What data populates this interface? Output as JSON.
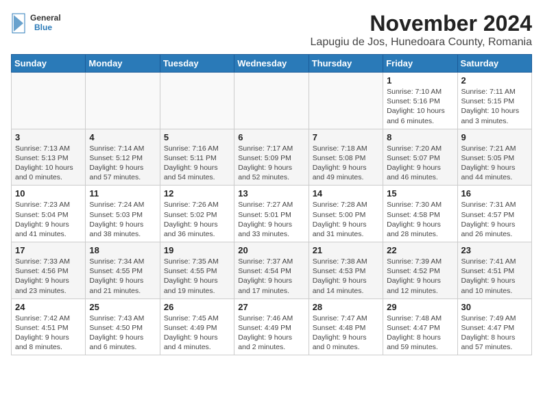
{
  "header": {
    "logo_general": "General",
    "logo_blue": "Blue",
    "month_title": "November 2024",
    "location": "Lapugiu de Jos, Hunedoara County, Romania"
  },
  "weekdays": [
    "Sunday",
    "Monday",
    "Tuesday",
    "Wednesday",
    "Thursday",
    "Friday",
    "Saturday"
  ],
  "weeks": [
    [
      {
        "day": "",
        "info": ""
      },
      {
        "day": "",
        "info": ""
      },
      {
        "day": "",
        "info": ""
      },
      {
        "day": "",
        "info": ""
      },
      {
        "day": "",
        "info": ""
      },
      {
        "day": "1",
        "info": "Sunrise: 7:10 AM\nSunset: 5:16 PM\nDaylight: 10 hours\nand 6 minutes."
      },
      {
        "day": "2",
        "info": "Sunrise: 7:11 AM\nSunset: 5:15 PM\nDaylight: 10 hours\nand 3 minutes."
      }
    ],
    [
      {
        "day": "3",
        "info": "Sunrise: 7:13 AM\nSunset: 5:13 PM\nDaylight: 10 hours\nand 0 minutes."
      },
      {
        "day": "4",
        "info": "Sunrise: 7:14 AM\nSunset: 5:12 PM\nDaylight: 9 hours\nand 57 minutes."
      },
      {
        "day": "5",
        "info": "Sunrise: 7:16 AM\nSunset: 5:11 PM\nDaylight: 9 hours\nand 54 minutes."
      },
      {
        "day": "6",
        "info": "Sunrise: 7:17 AM\nSunset: 5:09 PM\nDaylight: 9 hours\nand 52 minutes."
      },
      {
        "day": "7",
        "info": "Sunrise: 7:18 AM\nSunset: 5:08 PM\nDaylight: 9 hours\nand 49 minutes."
      },
      {
        "day": "8",
        "info": "Sunrise: 7:20 AM\nSunset: 5:07 PM\nDaylight: 9 hours\nand 46 minutes."
      },
      {
        "day": "9",
        "info": "Sunrise: 7:21 AM\nSunset: 5:05 PM\nDaylight: 9 hours\nand 44 minutes."
      }
    ],
    [
      {
        "day": "10",
        "info": "Sunrise: 7:23 AM\nSunset: 5:04 PM\nDaylight: 9 hours\nand 41 minutes."
      },
      {
        "day": "11",
        "info": "Sunrise: 7:24 AM\nSunset: 5:03 PM\nDaylight: 9 hours\nand 38 minutes."
      },
      {
        "day": "12",
        "info": "Sunrise: 7:26 AM\nSunset: 5:02 PM\nDaylight: 9 hours\nand 36 minutes."
      },
      {
        "day": "13",
        "info": "Sunrise: 7:27 AM\nSunset: 5:01 PM\nDaylight: 9 hours\nand 33 minutes."
      },
      {
        "day": "14",
        "info": "Sunrise: 7:28 AM\nSunset: 5:00 PM\nDaylight: 9 hours\nand 31 minutes."
      },
      {
        "day": "15",
        "info": "Sunrise: 7:30 AM\nSunset: 4:58 PM\nDaylight: 9 hours\nand 28 minutes."
      },
      {
        "day": "16",
        "info": "Sunrise: 7:31 AM\nSunset: 4:57 PM\nDaylight: 9 hours\nand 26 minutes."
      }
    ],
    [
      {
        "day": "17",
        "info": "Sunrise: 7:33 AM\nSunset: 4:56 PM\nDaylight: 9 hours\nand 23 minutes."
      },
      {
        "day": "18",
        "info": "Sunrise: 7:34 AM\nSunset: 4:55 PM\nDaylight: 9 hours\nand 21 minutes."
      },
      {
        "day": "19",
        "info": "Sunrise: 7:35 AM\nSunset: 4:55 PM\nDaylight: 9 hours\nand 19 minutes."
      },
      {
        "day": "20",
        "info": "Sunrise: 7:37 AM\nSunset: 4:54 PM\nDaylight: 9 hours\nand 17 minutes."
      },
      {
        "day": "21",
        "info": "Sunrise: 7:38 AM\nSunset: 4:53 PM\nDaylight: 9 hours\nand 14 minutes."
      },
      {
        "day": "22",
        "info": "Sunrise: 7:39 AM\nSunset: 4:52 PM\nDaylight: 9 hours\nand 12 minutes."
      },
      {
        "day": "23",
        "info": "Sunrise: 7:41 AM\nSunset: 4:51 PM\nDaylight: 9 hours\nand 10 minutes."
      }
    ],
    [
      {
        "day": "24",
        "info": "Sunrise: 7:42 AM\nSunset: 4:51 PM\nDaylight: 9 hours\nand 8 minutes."
      },
      {
        "day": "25",
        "info": "Sunrise: 7:43 AM\nSunset: 4:50 PM\nDaylight: 9 hours\nand 6 minutes."
      },
      {
        "day": "26",
        "info": "Sunrise: 7:45 AM\nSunset: 4:49 PM\nDaylight: 9 hours\nand 4 minutes."
      },
      {
        "day": "27",
        "info": "Sunrise: 7:46 AM\nSunset: 4:49 PM\nDaylight: 9 hours\nand 2 minutes."
      },
      {
        "day": "28",
        "info": "Sunrise: 7:47 AM\nSunset: 4:48 PM\nDaylight: 9 hours\nand 0 minutes."
      },
      {
        "day": "29",
        "info": "Sunrise: 7:48 AM\nSunset: 4:47 PM\nDaylight: 8 hours\nand 59 minutes."
      },
      {
        "day": "30",
        "info": "Sunrise: 7:49 AM\nSunset: 4:47 PM\nDaylight: 8 hours\nand 57 minutes."
      }
    ]
  ]
}
